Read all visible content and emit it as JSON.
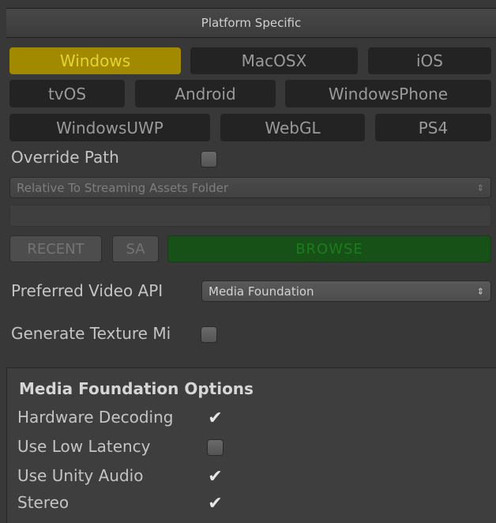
{
  "header": {
    "title": "Platform Specific"
  },
  "platforms": {
    "row1": [
      "Windows",
      "MacOSX",
      "iOS"
    ],
    "row2": [
      "tvOS",
      "Android",
      "WindowsPhone"
    ],
    "row3": [
      "WindowsUWP",
      "WebGL",
      "PS4"
    ],
    "selected": "Windows"
  },
  "override_path": {
    "label": "Override Path",
    "checked": false
  },
  "path_dropdown": {
    "value": "Relative To Streaming Assets Folder"
  },
  "path_buttons": {
    "recent": "RECENT",
    "sa": "SA",
    "browse": "BROWSE"
  },
  "video_api": {
    "label": "Preferred Video API",
    "value": "Media Foundation"
  },
  "generate_mips": {
    "label": "Generate Texture Mi",
    "checked": false
  },
  "mf_options": {
    "title": "Media Foundation Options",
    "items": [
      {
        "label": "Hardware Decoding",
        "checked": true
      },
      {
        "label": "Use Low Latency",
        "checked": false
      },
      {
        "label": "Use Unity Audio",
        "checked": true
      },
      {
        "label": "Stereo",
        "checked": true
      }
    ]
  },
  "colors": {
    "active_platform": "#a28a00",
    "browse": "#175117"
  }
}
